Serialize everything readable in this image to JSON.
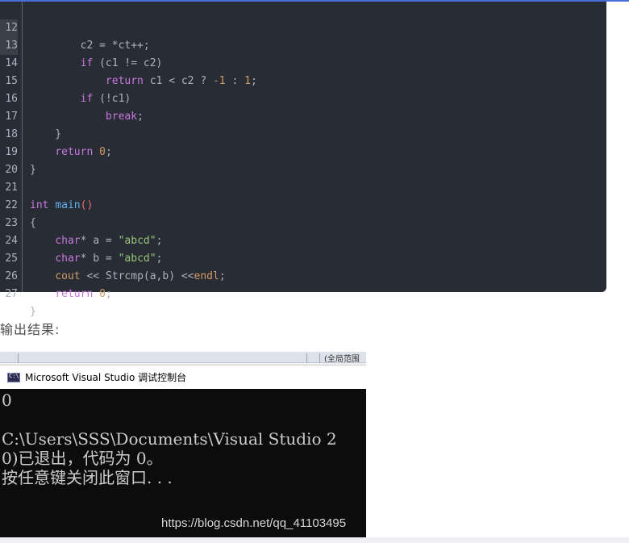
{
  "code": {
    "highlighted_lines": [
      "12",
      "13"
    ],
    "lines": [
      {
        "n": "12",
        "text": "        c2 = *ct++;"
      },
      {
        "n": "13",
        "text": "        if (c1 != c2)"
      },
      {
        "n": "14",
        "text": "            return c1 < c2 ? -1 : 1;"
      },
      {
        "n": "15",
        "text": "        if (!c1)"
      },
      {
        "n": "16",
        "text": "            break;"
      },
      {
        "n": "17",
        "text": "    }"
      },
      {
        "n": "18",
        "text": "    return 0;"
      },
      {
        "n": "19",
        "text": "}"
      },
      {
        "n": "20",
        "text": ""
      },
      {
        "n": "21",
        "text": "int main()"
      },
      {
        "n": "22",
        "text": "{"
      },
      {
        "n": "23",
        "text": "    char* a = \"abcd\";"
      },
      {
        "n": "24",
        "text": "    char* b = \"abcd\";"
      },
      {
        "n": "25",
        "text": "    cout << Strcmp(a,b) <<endl;"
      },
      {
        "n": "26",
        "text": "    return 0;"
      },
      {
        "n": "27",
        "text": "}"
      }
    ]
  },
  "result_label": "输出结果:",
  "screenshot": {
    "strip_fragment": "(全局范围",
    "window_title": "Microsoft Visual Studio 调试控制台",
    "console_lines": [
      "0",
      "",
      "C:\\Users\\SSS\\Documents\\Visual Studio 2",
      "0)已退出，代码为 0。",
      "按任意键关闭此窗口. . ."
    ],
    "watermark": "https://blog.csdn.net/qq_41103495"
  }
}
